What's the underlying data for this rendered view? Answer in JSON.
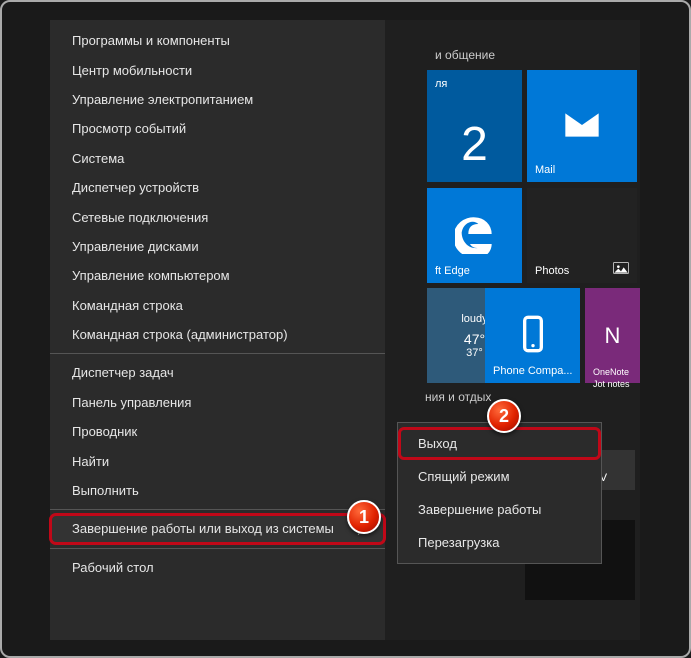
{
  "winx": {
    "items_top": [
      "Программы и компоненты",
      "Центр мобильности",
      "Управление электропитанием",
      "Просмотр событий",
      "Система",
      "Диспетчер устройств",
      "Сетевые подключения",
      "Управление дисками",
      "Управление компьютером",
      "Командная строка",
      "Командная строка (администратор)"
    ],
    "items_mid": [
      "Диспетчер задач",
      "Панель управления",
      "Проводник",
      "Найти",
      "Выполнить"
    ],
    "shutdown_label": "Завершение работы или выход из системы",
    "items_bot": [
      "Рабочий стол"
    ]
  },
  "submenu": {
    "items": [
      "Выход",
      "Спящий режим",
      "Завершение работы",
      "Перезагрузка"
    ]
  },
  "markers": {
    "one": "1",
    "two": "2"
  },
  "tiles": {
    "group1": "и общение",
    "group2": "ния и отдых",
    "cal_day": "2",
    "cal_month": "ля",
    "mail": "Mail",
    "edge": "ft Edge",
    "photos": "Photos",
    "weather_cond": "loudy",
    "weather_hi": "47°",
    "weather_lo": "37°",
    "phone": "Phone Compa...",
    "onenote_a": "OneNote",
    "onenote_b": "Jot notes",
    "tv": "TV"
  }
}
